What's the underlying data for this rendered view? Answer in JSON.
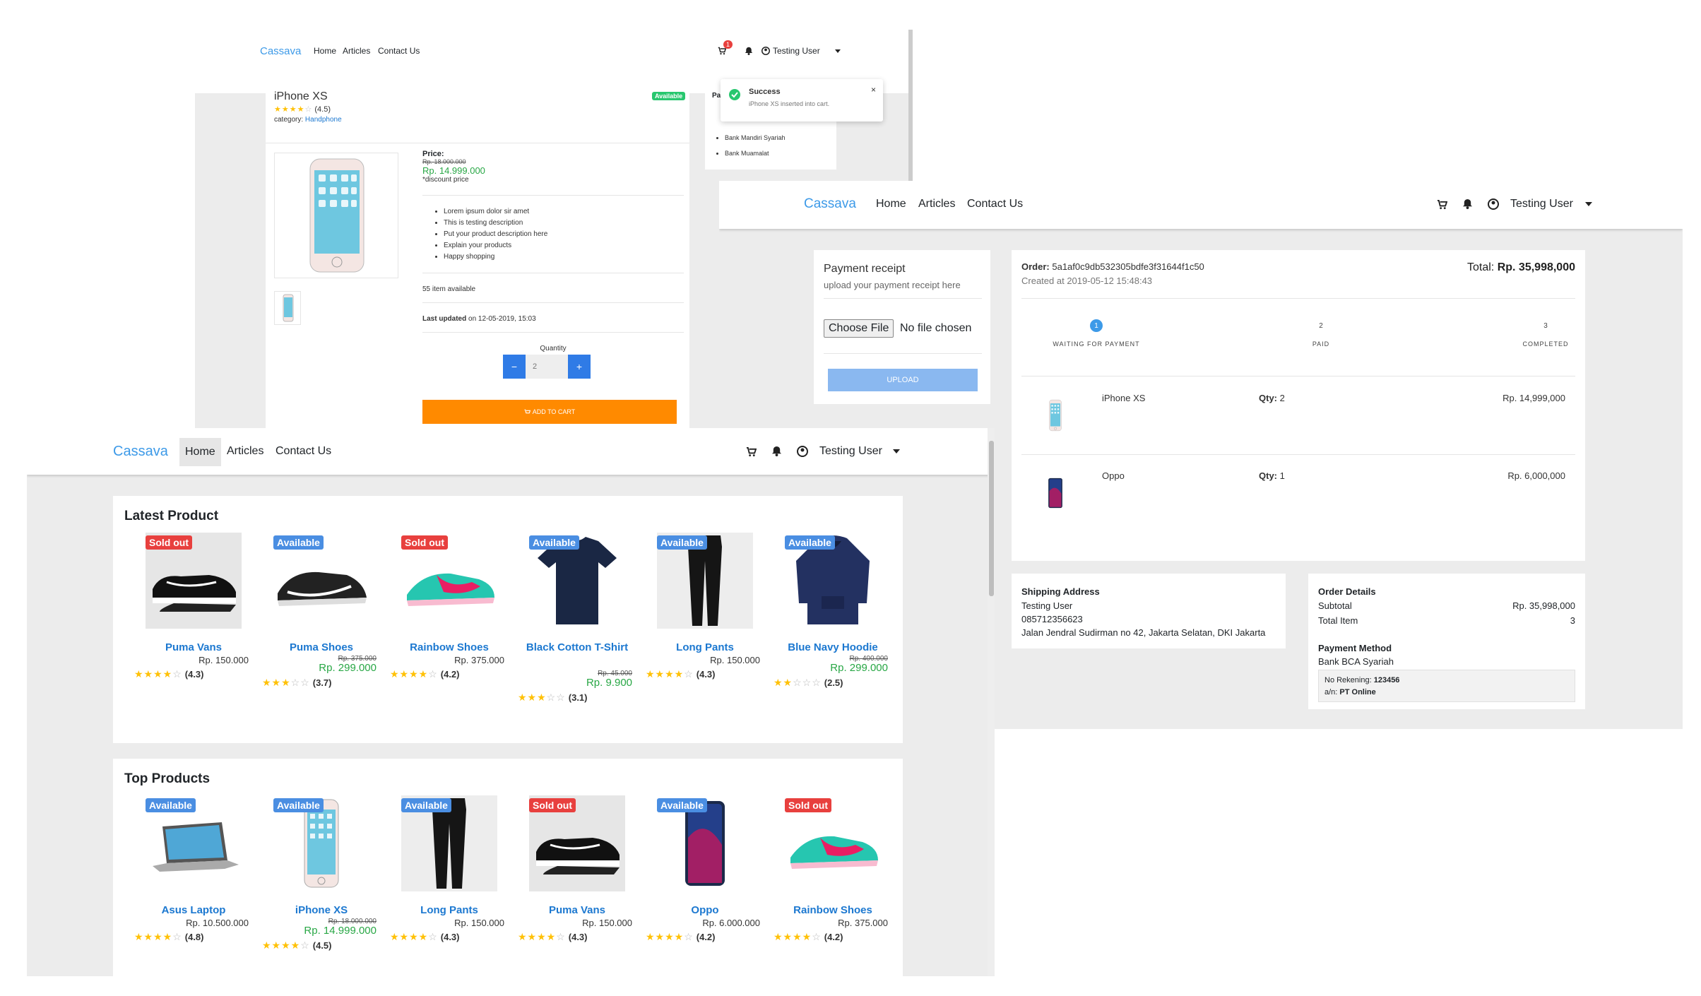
{
  "brand": "Cassava",
  "nav": {
    "home": "Home",
    "articles": "Articles",
    "contact": "Contact Us",
    "user": "Testing User",
    "cart_count": "1"
  },
  "detail": {
    "title": "iPhone XS",
    "rating": "(4.5)",
    "category_label": "category:",
    "category": "Handphone",
    "status": "Available",
    "price_label": "Price:",
    "old_price": "Rp. 18.000.000",
    "price": "Rp. 14.999.000",
    "discount_note": "*discount price",
    "features": [
      "Lorem ipsum dolor sir amet",
      "This is testing description",
      "Put your product description here",
      "Explain your products",
      "Happy shopping"
    ],
    "stock": "55 item available",
    "last_updated_label": "Last updated",
    "last_updated_on": "on 12-05-2019, 15:03",
    "quantity_label": "Quantity",
    "quantity_value": "2",
    "minus": "−",
    "plus": "+",
    "add_to_cart": "ADD TO CART",
    "payment_partial": "Pa",
    "banks": [
      "Bank Mandiri Syariah",
      "Bank Muamalat"
    ],
    "toast_title": "Success",
    "toast_message": "iPhone XS inserted into cart.",
    "toast_close": "×"
  },
  "order": {
    "receipt_title": "Payment receipt",
    "receipt_sub": "upload your payment receipt here",
    "choose_file": "Choose File",
    "no_file": "No file chosen",
    "upload": "UPLOAD",
    "order_label": "Order:",
    "order_id": "5a1af0c9db532305bdfe3f31644f1c50",
    "created": "Created at 2019-05-12 15:48:43",
    "total_label": "Total:",
    "total": "Rp. 35,998,000",
    "steps": [
      {
        "num": "1",
        "label": "WAITING FOR PAYMENT"
      },
      {
        "num": "2",
        "label": "PAID"
      },
      {
        "num": "3",
        "label": "COMPLETED"
      }
    ],
    "items": [
      {
        "name": "iPhone XS",
        "qty_label": "Qty:",
        "qty": "2",
        "price": "Rp. 14,999,000"
      },
      {
        "name": "Oppo",
        "qty_label": "Qty:",
        "qty": "1",
        "price": "Rp. 6,000,000"
      }
    ],
    "shipping_title": "Shipping Address",
    "shipping_name": "Testing User",
    "shipping_phone": "085712356623",
    "shipping_address": "Jalan Jendral Sudirman no 42, Jakarta Selatan, DKI Jakarta",
    "details_title": "Order Details",
    "subtotal_label": "Subtotal",
    "subtotal": "Rp. 35,998,000",
    "total_item_label": "Total Item",
    "total_item": "3",
    "payment_title": "Payment Method",
    "payment_bank": "Bank BCA Syariah",
    "rekening_label": "No Rekening:",
    "rekening": "123456",
    "an_label": "a/n:",
    "an": "PT Online"
  },
  "home": {
    "latest_title": "Latest Product",
    "top_title": "Top Products",
    "latest": [
      {
        "name": "Puma Vans",
        "status": "Sold out",
        "price": "Rp. 150.000",
        "old": "",
        "sale": "",
        "rating": "(4.3)",
        "stars": 4,
        "img": "shoe-black"
      },
      {
        "name": "Puma Shoes",
        "status": "Available",
        "price": "",
        "old": "Rp. 375.000",
        "sale": "Rp. 299.000",
        "rating": "(3.7)",
        "stars": 3,
        "img": "shoe-nike"
      },
      {
        "name": "Rainbow Shoes",
        "status": "Sold out",
        "price": "Rp. 375.000",
        "old": "",
        "sale": "",
        "rating": "(4.2)",
        "stars": 4,
        "img": "shoe-teal"
      },
      {
        "name": "Black Cotton T-Shirt",
        "status": "Available",
        "price": "",
        "old": "Rp. 45.000",
        "sale": "Rp. 9.900",
        "rating": "(3.1)",
        "stars": 3,
        "img": "tshirt"
      },
      {
        "name": "Long Pants",
        "status": "Available",
        "price": "Rp. 150.000",
        "old": "",
        "sale": "",
        "rating": "(4.3)",
        "stars": 4,
        "img": "pants"
      },
      {
        "name": "Blue Navy Hoodie",
        "status": "Available",
        "price": "",
        "old": "Rp. 400.000",
        "sale": "Rp. 299.000",
        "rating": "(2.5)",
        "stars": 2,
        "img": "hoodie"
      }
    ],
    "top": [
      {
        "name": "Asus Laptop",
        "status": "Available",
        "price": "Rp. 10.500.000",
        "old": "",
        "sale": "",
        "rating": "(4.8)",
        "stars": 4,
        "img": "laptop"
      },
      {
        "name": "iPhone XS",
        "status": "Available",
        "price": "",
        "old": "Rp. 18.000.000",
        "sale": "Rp. 14.999.000",
        "rating": "(4.5)",
        "stars": 4,
        "img": "iphone"
      },
      {
        "name": "Long Pants",
        "status": "Available",
        "price": "Rp. 150.000",
        "old": "",
        "sale": "",
        "rating": "(4.3)",
        "stars": 4,
        "img": "pants"
      },
      {
        "name": "Puma Vans",
        "status": "Sold out",
        "price": "Rp. 150.000",
        "old": "",
        "sale": "",
        "rating": "(4.3)",
        "stars": 4,
        "img": "shoe-black"
      },
      {
        "name": "Oppo",
        "status": "Available",
        "price": "Rp. 6.000.000",
        "old": "",
        "sale": "",
        "rating": "(4.2)",
        "stars": 4,
        "img": "oppo"
      },
      {
        "name": "Rainbow Shoes",
        "status": "Sold out",
        "price": "Rp. 375.000",
        "old": "",
        "sale": "",
        "rating": "(4.2)",
        "stars": 4,
        "img": "shoe-teal"
      }
    ]
  },
  "colors": {
    "brand": "#3d9ae8",
    "available": "#4a8ee2",
    "soldout": "#e8403e",
    "price_green": "#28a745",
    "orange": "#ff8a00",
    "link": "#1c78d0"
  }
}
